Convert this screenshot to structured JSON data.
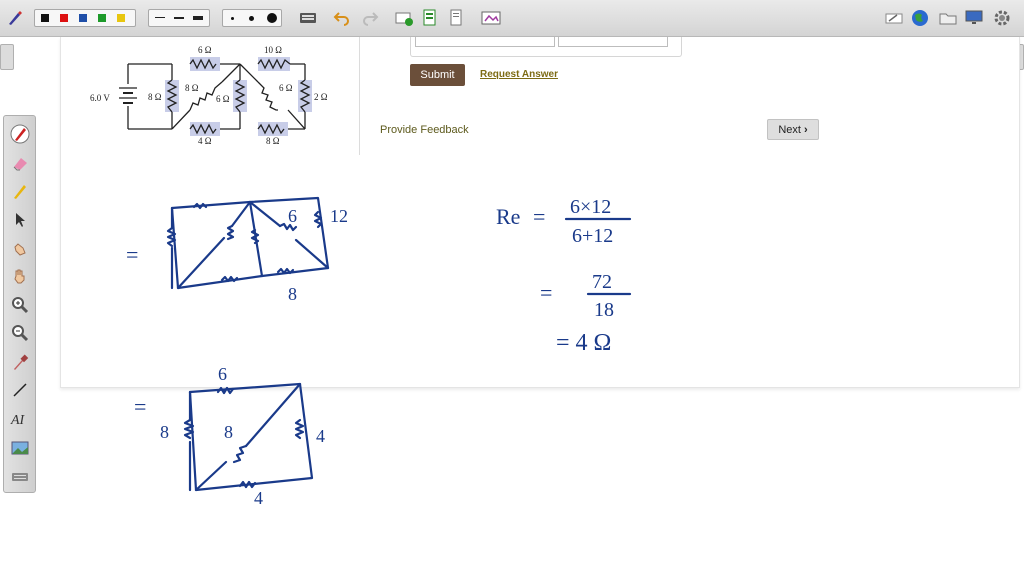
{
  "question": {
    "submit_label": "Submit",
    "request_answer_label": "Request Answer",
    "provide_feedback_label": "Provide Feedback",
    "next_label": "Next"
  },
  "circuit": {
    "battery": "6.0 V",
    "r_top_left": "6 Ω",
    "r_top_right": "10 Ω",
    "r_left": "8 Ω",
    "r_diag_left": "8 Ω",
    "r_middle": "6 Ω",
    "r_diag_right": "6 Ω",
    "r_right": "2 Ω",
    "r_bottom_left": "4 Ω",
    "r_bottom_right": "8 Ω"
  },
  "handwriting": {
    "sketch1_equals": "=",
    "sketch1_label_6": "6",
    "sketch1_label_12": "12",
    "sketch1_label_8": "8",
    "formula_lhs": "Re",
    "formula_eq": "=",
    "formula_num": "6×12",
    "formula_den": "6+12",
    "step2_eq": "=",
    "step2_num": "72",
    "step2_den": "18",
    "step3": "= 4 Ω",
    "sketch2_equals": "=",
    "sketch2_label_top": "6",
    "sketch2_label_left": "8",
    "sketch2_label_diag": "8",
    "sketch2_label_right": "4",
    "sketch2_label_bottom": "4"
  },
  "colors": {
    "ink": "#1a3a8a",
    "submit_bg": "#6b4f3a",
    "link": "#7d6b13"
  }
}
